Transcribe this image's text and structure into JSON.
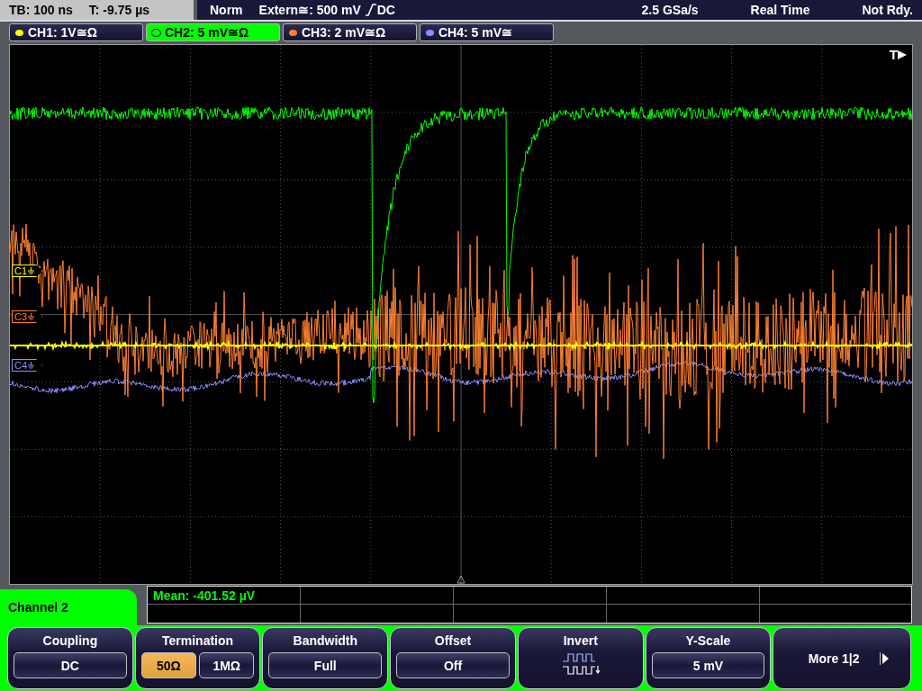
{
  "status_bar": {
    "timebase": "TB: 100 ns",
    "trigger_time": "T: -9.75 µs",
    "trigger_mode": "Norm",
    "trigger_source": "Extern≅: 500 mV",
    "trigger_coupling": "DC",
    "sample_rate": "2.5 GSa/s",
    "acquisition": "Real Time",
    "state": "Not Rdy."
  },
  "channels": [
    {
      "label": "CH1: 1V≅Ω",
      "color": "#ffff00",
      "selected": false
    },
    {
      "label": "CH2: 5 mV≅Ω",
      "color": "#00ff00",
      "selected": true
    },
    {
      "label": "CH3: 2 mV≅Ω",
      "color": "#ff8030",
      "selected": false
    },
    {
      "label": "CH4: 5 mV≅",
      "color": "#8c8cff",
      "selected": false
    }
  ],
  "display": {
    "trigger_label": "T",
    "markers": [
      {
        "label": "C1",
        "color": "#ffff00"
      },
      {
        "label": "C3",
        "color": "#ff8030"
      },
      {
        "label": "C4",
        "color": "#8c8cff"
      }
    ]
  },
  "measurement": {
    "label": "Mean: -401.52 µV"
  },
  "menu": {
    "title": "Channel 2",
    "softkeys": [
      {
        "kind": "value",
        "title": "Coupling",
        "value": "DC"
      },
      {
        "kind": "options",
        "title": "Termination",
        "options": [
          {
            "label": "50Ω",
            "selected": true
          },
          {
            "label": "1MΩ",
            "selected": false
          }
        ]
      },
      {
        "kind": "value",
        "title": "Bandwidth",
        "value": "Full"
      },
      {
        "kind": "value",
        "title": "Offset",
        "value": "Off"
      },
      {
        "kind": "icon",
        "title": "Invert"
      },
      {
        "kind": "value",
        "title": "Y-Scale",
        "value": "5 mV"
      },
      {
        "kind": "next",
        "title": "More 1|2"
      }
    ]
  }
}
